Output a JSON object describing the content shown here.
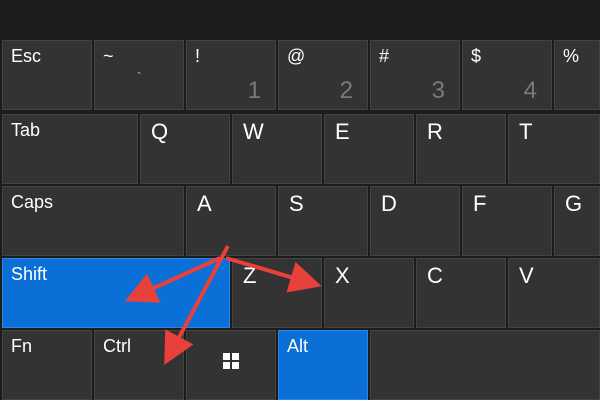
{
  "keys": {
    "esc": "Esc",
    "tilde": {
      "top": "~",
      "bottom": "`"
    },
    "one": {
      "top": "!",
      "bottom": "1"
    },
    "two": {
      "top": "@",
      "bottom": "2"
    },
    "three": {
      "top": "#",
      "bottom": "3"
    },
    "four": {
      "top": "$",
      "bottom": "4"
    },
    "five": {
      "top": "%"
    },
    "tab": "Tab",
    "q": "Q",
    "w": "W",
    "e": "E",
    "r": "R",
    "t": "T",
    "caps": "Caps",
    "a": "A",
    "s": "S",
    "d": "D",
    "f": "F",
    "g": "G",
    "shift": "Shift",
    "z": "Z",
    "x": "X",
    "c": "C",
    "v": "V",
    "fn": "Fn",
    "ctrl": "Ctrl",
    "alt": "Alt"
  },
  "icons": {
    "windows": "windows-logo-icon"
  },
  "colors": {
    "key": "#333333",
    "active": "#0a6fd6",
    "arrow": "#e8403a",
    "text": "#ffffff",
    "subtext": "#7a7a7a"
  }
}
